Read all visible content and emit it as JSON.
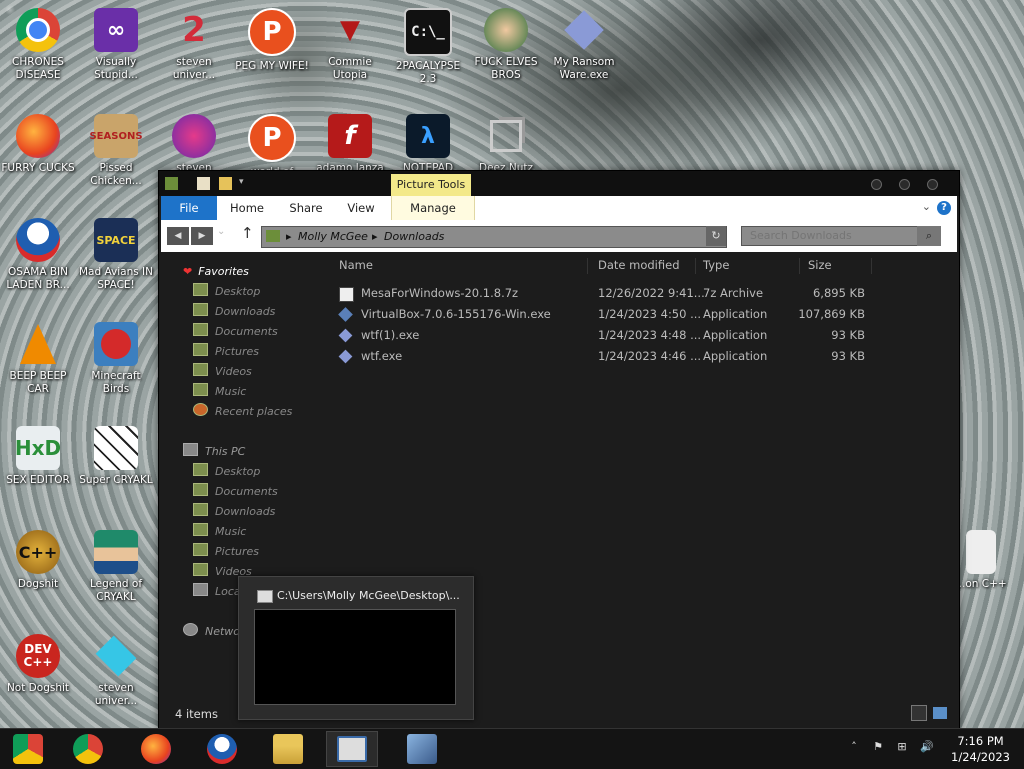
{
  "desktop": {
    "icons": [
      {
        "label": "CHRONES DISEASE"
      },
      {
        "label": "Visually Stupid..."
      },
      {
        "label": "steven univer..."
      },
      {
        "label": "PEG MY WIFE!"
      },
      {
        "label": "Commie Utopia"
      },
      {
        "label": "2PACALYPSE 2.3"
      },
      {
        "label": "FUCK ELVES BROS"
      },
      {
        "label": "My Ransom Ware.exe"
      },
      {
        "label": "FURRY CUCKS"
      },
      {
        "label": "Pissed Chicken..."
      },
      {
        "label": "steven"
      },
      {
        "label": "world of"
      },
      {
        "label": "adamo lanza"
      },
      {
        "label": "NOTEPAD"
      },
      {
        "label": "Deez Nutz"
      },
      {
        "label": "OSAMA BIN LADEN BR..."
      },
      {
        "label": "Mad Avians IN SPACE!"
      },
      {
        "label": "BEEP BEEP CAR"
      },
      {
        "label": "Minecraft Birds"
      },
      {
        "label": "SEX EDITOR"
      },
      {
        "label": "Super CRYAKL"
      },
      {
        "label": "Dogshit"
      },
      {
        "label": "Legend of CRYAKL"
      },
      {
        "label": "Not Dogshit"
      },
      {
        "label": "steven univer..."
      },
      {
        "label": "...on C++"
      }
    ]
  },
  "explorer": {
    "contextual_tab": "Picture Tools",
    "tabs": [
      "File",
      "Home",
      "Share",
      "View",
      "Manage"
    ],
    "breadcrumb": [
      "Molly McGee",
      "Downloads"
    ],
    "search_placeholder": "Search Downloads",
    "nav": {
      "favorites_label": "Favorites",
      "favorites": [
        "Desktop",
        "Downloads",
        "Documents",
        "Pictures",
        "Videos",
        "Music",
        "Recent places"
      ],
      "thispc_label": "This PC",
      "thispc": [
        "Desktop",
        "Documents",
        "Downloads",
        "Music",
        "Pictures",
        "Videos",
        "Local"
      ],
      "network_label": "Network"
    },
    "columns": [
      "Name",
      "Date modified",
      "Type",
      "Size"
    ],
    "files": [
      {
        "name": "MesaForWindows-20.1.8.7z",
        "date": "12/26/2022 9:41...",
        "type": "7z Archive",
        "size": "6,895 KB"
      },
      {
        "name": "VirtualBox-7.0.6-155176-Win.exe",
        "date": "1/24/2023 4:50 ...",
        "type": "Application",
        "size": "107,869 KB"
      },
      {
        "name": "wtf(1).exe",
        "date": "1/24/2023 4:48 ...",
        "type": "Application",
        "size": "93 KB"
      },
      {
        "name": "wtf.exe",
        "date": "1/24/2023 4:46 ...",
        "type": "Application",
        "size": "93 KB"
      }
    ],
    "status": "4 items"
  },
  "thumbnail": {
    "title": "C:\\Users\\Molly McGee\\Desktop\\..."
  },
  "taskbar": {
    "icons": [
      "chrome-alt-icon",
      "chrome-icon",
      "firefox-icon",
      "obama-icon",
      "file-explorer-icon",
      "console-window-icon",
      "network-setup-icon"
    ],
    "time": "7:16 PM",
    "date": "1/24/2023"
  },
  "colors": {
    "accent": "#1e73c9",
    "window_bg": "#1c1c1c",
    "contextual_tab": "#f3e98a"
  }
}
